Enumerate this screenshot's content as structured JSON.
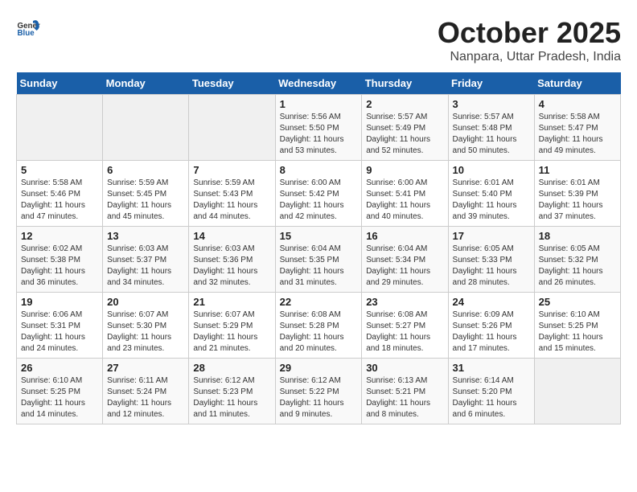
{
  "header": {
    "logo_general": "General",
    "logo_blue": "Blue",
    "title": "October 2025",
    "subtitle": "Nanpara, Uttar Pradesh, India"
  },
  "days_of_week": [
    "Sunday",
    "Monday",
    "Tuesday",
    "Wednesday",
    "Thursday",
    "Friday",
    "Saturday"
  ],
  "weeks": [
    [
      {
        "day": "",
        "sunrise": "",
        "sunset": "",
        "daylight": "",
        "empty": true
      },
      {
        "day": "",
        "sunrise": "",
        "sunset": "",
        "daylight": "",
        "empty": true
      },
      {
        "day": "",
        "sunrise": "",
        "sunset": "",
        "daylight": "",
        "empty": true
      },
      {
        "day": "1",
        "sunrise": "Sunrise: 5:56 AM",
        "sunset": "Sunset: 5:50 PM",
        "daylight": "Daylight: 11 hours and 53 minutes."
      },
      {
        "day": "2",
        "sunrise": "Sunrise: 5:57 AM",
        "sunset": "Sunset: 5:49 PM",
        "daylight": "Daylight: 11 hours and 52 minutes."
      },
      {
        "day": "3",
        "sunrise": "Sunrise: 5:57 AM",
        "sunset": "Sunset: 5:48 PM",
        "daylight": "Daylight: 11 hours and 50 minutes."
      },
      {
        "day": "4",
        "sunrise": "Sunrise: 5:58 AM",
        "sunset": "Sunset: 5:47 PM",
        "daylight": "Daylight: 11 hours and 49 minutes."
      }
    ],
    [
      {
        "day": "5",
        "sunrise": "Sunrise: 5:58 AM",
        "sunset": "Sunset: 5:46 PM",
        "daylight": "Daylight: 11 hours and 47 minutes."
      },
      {
        "day": "6",
        "sunrise": "Sunrise: 5:59 AM",
        "sunset": "Sunset: 5:45 PM",
        "daylight": "Daylight: 11 hours and 45 minutes."
      },
      {
        "day": "7",
        "sunrise": "Sunrise: 5:59 AM",
        "sunset": "Sunset: 5:43 PM",
        "daylight": "Daylight: 11 hours and 44 minutes."
      },
      {
        "day": "8",
        "sunrise": "Sunrise: 6:00 AM",
        "sunset": "Sunset: 5:42 PM",
        "daylight": "Daylight: 11 hours and 42 minutes."
      },
      {
        "day": "9",
        "sunrise": "Sunrise: 6:00 AM",
        "sunset": "Sunset: 5:41 PM",
        "daylight": "Daylight: 11 hours and 40 minutes."
      },
      {
        "day": "10",
        "sunrise": "Sunrise: 6:01 AM",
        "sunset": "Sunset: 5:40 PM",
        "daylight": "Daylight: 11 hours and 39 minutes."
      },
      {
        "day": "11",
        "sunrise": "Sunrise: 6:01 AM",
        "sunset": "Sunset: 5:39 PM",
        "daylight": "Daylight: 11 hours and 37 minutes."
      }
    ],
    [
      {
        "day": "12",
        "sunrise": "Sunrise: 6:02 AM",
        "sunset": "Sunset: 5:38 PM",
        "daylight": "Daylight: 11 hours and 36 minutes."
      },
      {
        "day": "13",
        "sunrise": "Sunrise: 6:03 AM",
        "sunset": "Sunset: 5:37 PM",
        "daylight": "Daylight: 11 hours and 34 minutes."
      },
      {
        "day": "14",
        "sunrise": "Sunrise: 6:03 AM",
        "sunset": "Sunset: 5:36 PM",
        "daylight": "Daylight: 11 hours and 32 minutes."
      },
      {
        "day": "15",
        "sunrise": "Sunrise: 6:04 AM",
        "sunset": "Sunset: 5:35 PM",
        "daylight": "Daylight: 11 hours and 31 minutes."
      },
      {
        "day": "16",
        "sunrise": "Sunrise: 6:04 AM",
        "sunset": "Sunset: 5:34 PM",
        "daylight": "Daylight: 11 hours and 29 minutes."
      },
      {
        "day": "17",
        "sunrise": "Sunrise: 6:05 AM",
        "sunset": "Sunset: 5:33 PM",
        "daylight": "Daylight: 11 hours and 28 minutes."
      },
      {
        "day": "18",
        "sunrise": "Sunrise: 6:05 AM",
        "sunset": "Sunset: 5:32 PM",
        "daylight": "Daylight: 11 hours and 26 minutes."
      }
    ],
    [
      {
        "day": "19",
        "sunrise": "Sunrise: 6:06 AM",
        "sunset": "Sunset: 5:31 PM",
        "daylight": "Daylight: 11 hours and 24 minutes."
      },
      {
        "day": "20",
        "sunrise": "Sunrise: 6:07 AM",
        "sunset": "Sunset: 5:30 PM",
        "daylight": "Daylight: 11 hours and 23 minutes."
      },
      {
        "day": "21",
        "sunrise": "Sunrise: 6:07 AM",
        "sunset": "Sunset: 5:29 PM",
        "daylight": "Daylight: 11 hours and 21 minutes."
      },
      {
        "day": "22",
        "sunrise": "Sunrise: 6:08 AM",
        "sunset": "Sunset: 5:28 PM",
        "daylight": "Daylight: 11 hours and 20 minutes."
      },
      {
        "day": "23",
        "sunrise": "Sunrise: 6:08 AM",
        "sunset": "Sunset: 5:27 PM",
        "daylight": "Daylight: 11 hours and 18 minutes."
      },
      {
        "day": "24",
        "sunrise": "Sunrise: 6:09 AM",
        "sunset": "Sunset: 5:26 PM",
        "daylight": "Daylight: 11 hours and 17 minutes."
      },
      {
        "day": "25",
        "sunrise": "Sunrise: 6:10 AM",
        "sunset": "Sunset: 5:25 PM",
        "daylight": "Daylight: 11 hours and 15 minutes."
      }
    ],
    [
      {
        "day": "26",
        "sunrise": "Sunrise: 6:10 AM",
        "sunset": "Sunset: 5:25 PM",
        "daylight": "Daylight: 11 hours and 14 minutes."
      },
      {
        "day": "27",
        "sunrise": "Sunrise: 6:11 AM",
        "sunset": "Sunset: 5:24 PM",
        "daylight": "Daylight: 11 hours and 12 minutes."
      },
      {
        "day": "28",
        "sunrise": "Sunrise: 6:12 AM",
        "sunset": "Sunset: 5:23 PM",
        "daylight": "Daylight: 11 hours and 11 minutes."
      },
      {
        "day": "29",
        "sunrise": "Sunrise: 6:12 AM",
        "sunset": "Sunset: 5:22 PM",
        "daylight": "Daylight: 11 hours and 9 minutes."
      },
      {
        "day": "30",
        "sunrise": "Sunrise: 6:13 AM",
        "sunset": "Sunset: 5:21 PM",
        "daylight": "Daylight: 11 hours and 8 minutes."
      },
      {
        "day": "31",
        "sunrise": "Sunrise: 6:14 AM",
        "sunset": "Sunset: 5:20 PM",
        "daylight": "Daylight: 11 hours and 6 minutes."
      },
      {
        "day": "",
        "sunrise": "",
        "sunset": "",
        "daylight": "",
        "empty": true
      }
    ]
  ]
}
